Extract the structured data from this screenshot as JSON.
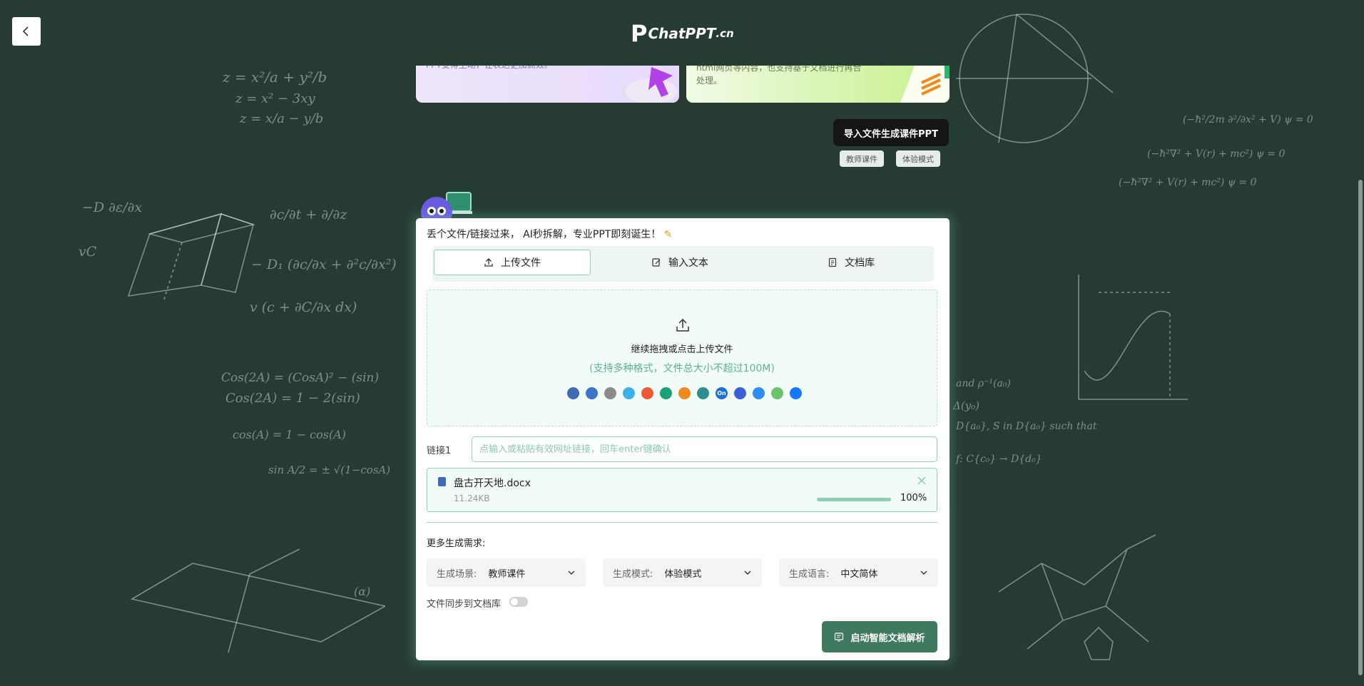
{
  "header": {
    "logo_text": "ChatPPT",
    "logo_suffix": ".cn"
  },
  "top_cards": {
    "card_a_text": "PPT变得生动，让表达更加高效。",
    "card_b_text_1": "html网页等内容，也支持基于文档进行再合",
    "card_b_text_2": "处理。"
  },
  "import_button": "导入文件生成课件PPT",
  "tags": [
    "教师课件",
    "体验模式"
  ],
  "panel": {
    "title": "丢个文件/链接过来， AI秒拆解，专业PPT即刻诞生！",
    "tabs": [
      {
        "label": "上传文件",
        "icon": "upload-icon",
        "active": true
      },
      {
        "label": "输入文本",
        "icon": "edit-icon",
        "active": false
      },
      {
        "label": "文档库",
        "icon": "document-icon",
        "active": false
      }
    ],
    "dropzone": {
      "main": "继续拖拽或点击上传文件",
      "sub": "(支持多种格式，文件总大小不超过100M)",
      "formats": [
        {
          "icon": "word-icon",
          "color": "#3f6bb4",
          "glyph": ""
        },
        {
          "icon": "ppt-icon",
          "color": "#3c74c9",
          "glyph": ""
        },
        {
          "icon": "txt-icon",
          "color": "#8a8a8a",
          "glyph": ""
        },
        {
          "icon": "cloud-icon",
          "color": "#3cb3e6",
          "glyph": ""
        },
        {
          "icon": "xmind-icon",
          "color": "#ee5a36",
          "glyph": ""
        },
        {
          "icon": "mindmaster-icon",
          "color": "#1aa177",
          "glyph": ""
        },
        {
          "icon": "butterfly-icon",
          "color": "#f08a1d",
          "glyph": ""
        },
        {
          "icon": "markdown-icon",
          "color": "#2d8c8c",
          "glyph": ""
        },
        {
          "icon": "onenote-icon",
          "color": "#1c6fd6",
          "glyph": "On"
        },
        {
          "icon": "lark-icon",
          "color": "#3a62d8",
          "glyph": ""
        },
        {
          "icon": "tencent-doc-icon",
          "color": "#2e8df0",
          "glyph": ""
        },
        {
          "icon": "wechat-icon",
          "color": "#6bc36b",
          "glyph": ""
        },
        {
          "icon": "dingtalk-icon",
          "color": "#1677ff",
          "glyph": ""
        }
      ]
    },
    "link": {
      "label": "链接1",
      "placeholder": "点输入或粘贴有效网址链接，回车enter键确认",
      "value": ""
    },
    "file": {
      "name": "盘古开天地.docx",
      "size": "11.24KB",
      "progress": 1.0,
      "progress_text": "100%"
    },
    "more_title": "更多生成需求:",
    "selects": [
      {
        "label": "生成场景:",
        "value": "教师课件"
      },
      {
        "label": "生成模式:",
        "value": "体验模式"
      },
      {
        "label": "生成语言:",
        "value": "中文简体"
      }
    ],
    "sync_label": "文件同步到文档库",
    "sync_on": false,
    "start_button": "启动智能文档解析"
  }
}
